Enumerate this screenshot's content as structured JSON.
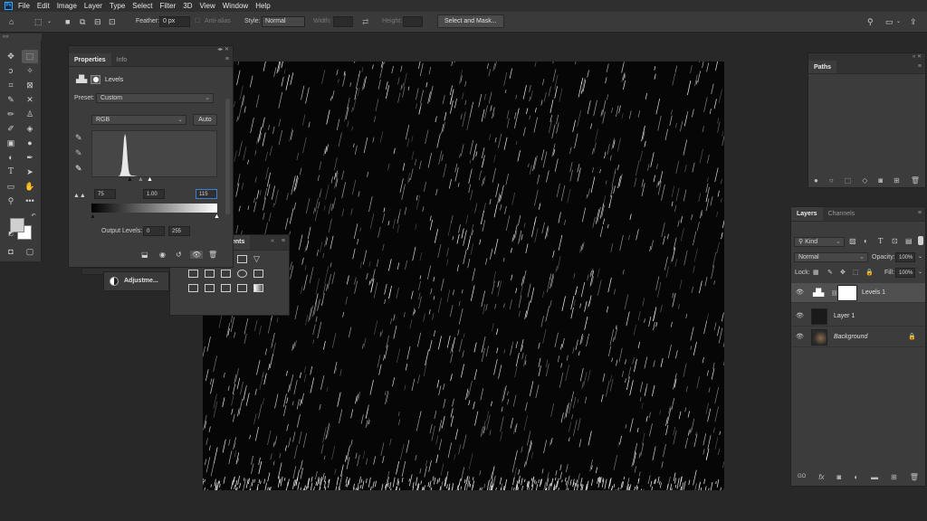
{
  "app": {
    "logo": "Ps"
  },
  "menu": [
    "File",
    "Edit",
    "Image",
    "Layer",
    "Type",
    "Select",
    "Filter",
    "3D",
    "View",
    "Window",
    "Help"
  ],
  "options": {
    "feather_label": "Feather:",
    "feather_value": "0 px",
    "antialias_label": "Anti-alias",
    "style_label": "Style:",
    "style_value": "Normal",
    "width_label": "Width:",
    "height_label": "Height:",
    "select_mask_button": "Select and Mask..."
  },
  "toolbar": {
    "grip": "««"
  },
  "properties": {
    "tabs": [
      "Properties",
      "Info"
    ],
    "adjustment_name": "Levels",
    "preset_label": "Preset:",
    "preset_value": "Custom",
    "channel_value": "RGB",
    "auto_button": "Auto",
    "input_black": "75",
    "input_gamma": "1.00",
    "input_white": "115",
    "output_label": "Output Levels:",
    "output_black": "0",
    "output_white": "255"
  },
  "adjustments_panel": {
    "tab_partial": "ents",
    "collapsed_label": "Adjustme..."
  },
  "paths_panel": {
    "tab": "Paths"
  },
  "layers_panel": {
    "tabs": [
      "Layers",
      "Channels"
    ],
    "filter_value": "Kind",
    "blend_mode": "Normal",
    "opacity_label": "Opacity:",
    "opacity_value": "100%",
    "lock_label": "Lock:",
    "fill_label": "Fill:",
    "fill_value": "100%",
    "layers": [
      {
        "name": "Levels 1",
        "selected": true
      },
      {
        "name": "Layer 1",
        "selected": false
      },
      {
        "name": "Background",
        "selected": false,
        "italic": true
      }
    ],
    "footer_link": "GO",
    "footer_fx": "fx"
  }
}
